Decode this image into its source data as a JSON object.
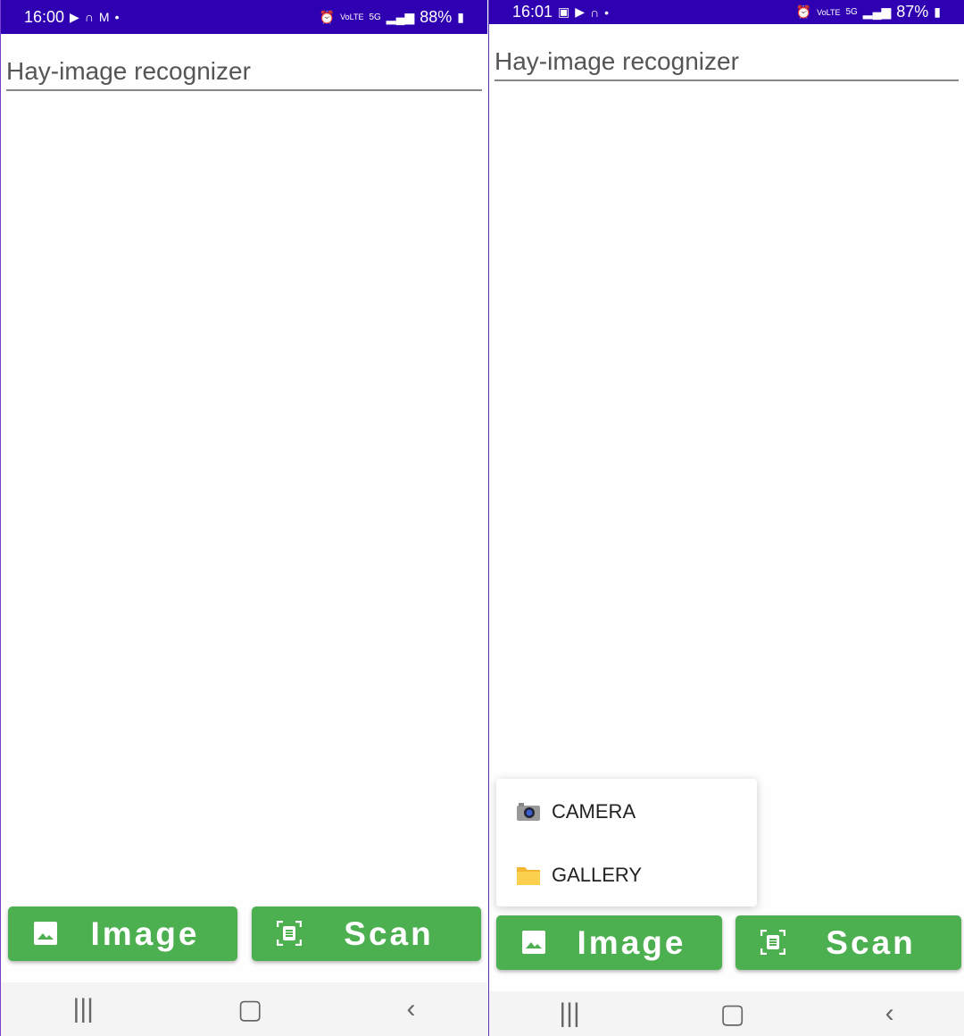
{
  "screens": [
    {
      "status": {
        "time": "16:00",
        "battery": "88%"
      },
      "title": "Hay-image recognizer",
      "buttons": {
        "image": "Image",
        "scan": "Scan"
      }
    },
    {
      "status": {
        "time": "16:01",
        "battery": "87%"
      },
      "title": "Hay-image recognizer",
      "buttons": {
        "image": "Image",
        "scan": "Scan"
      },
      "menu": [
        {
          "icon": "camera-icon",
          "label": "CAMERA"
        },
        {
          "icon": "folder-icon",
          "label": "GALLERY"
        }
      ]
    }
  ],
  "colors": {
    "status_bar": "#2f00b2",
    "button": "#4caf50"
  }
}
